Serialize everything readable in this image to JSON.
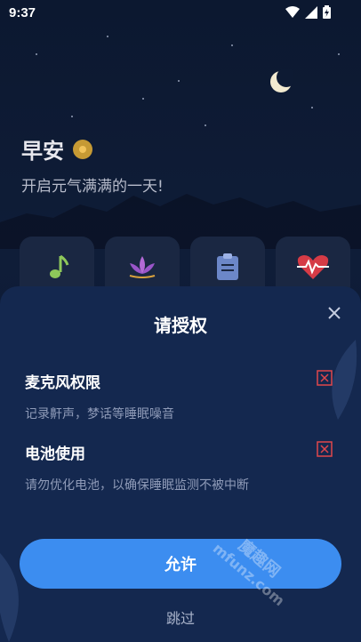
{
  "status_bar": {
    "time": "9:37"
  },
  "greeting": {
    "title": "早安",
    "subtitle": "开启元气满满的一天!"
  },
  "quick_actions": [
    {
      "icon": "music-note-icon"
    },
    {
      "icon": "lotus-icon"
    },
    {
      "icon": "clipboard-icon"
    },
    {
      "icon": "heartbeat-icon"
    }
  ],
  "dialog": {
    "title": "请授权",
    "permissions": [
      {
        "title": "麦克风权限",
        "description": "记录鼾声，梦话等睡眠噪音",
        "status": "denied"
      },
      {
        "title": "电池使用",
        "description": "请勿优化电池，以确保睡眠监测不被中断",
        "status": "denied"
      }
    ],
    "allow_label": "允许",
    "skip_label": "跳过"
  },
  "watermark": {
    "text1": "mfunz.com",
    "text2": "魔趣网"
  },
  "colors": {
    "accent": "#3c8df0",
    "sheet": "#14284f",
    "denied": "#e0474c"
  }
}
